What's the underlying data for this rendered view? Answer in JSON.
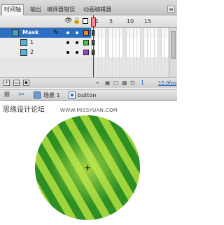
{
  "tabs": [
    {
      "label": "时间轴",
      "active": true
    },
    {
      "label": "输出",
      "active": false
    },
    {
      "label": "编译器错误",
      "active": false
    },
    {
      "label": "动画编辑器",
      "active": false
    }
  ],
  "panel_menu_icon": "menu-icon",
  "timeline": {
    "header_icons": [
      "eye-icon",
      "lock-icon",
      "outline-icon"
    ],
    "ruler": [
      "1",
      "5",
      "10",
      "15"
    ],
    "layers": [
      {
        "name": "Mask",
        "type": "mask",
        "selected": true,
        "swatch": "#f08a1c"
      },
      {
        "name": "1",
        "type": "masked",
        "selected": false,
        "swatch": "#3dcc3d"
      },
      {
        "name": "2",
        "type": "masked",
        "selected": false,
        "swatch": "#a040c8"
      }
    ],
    "footer": {
      "current_frame": "1",
      "fps": "12.0fps"
    }
  },
  "editbar": {
    "scene": "场景 1",
    "symbol": "button"
  },
  "stage": {
    "forum_name": "思缘设计论坛",
    "forum_url": "WWW.MISSYUAN.COM",
    "circle_colors": {
      "light": "#9fd43c",
      "dark": "#2e8f23",
      "center": "#c4ea52"
    }
  }
}
